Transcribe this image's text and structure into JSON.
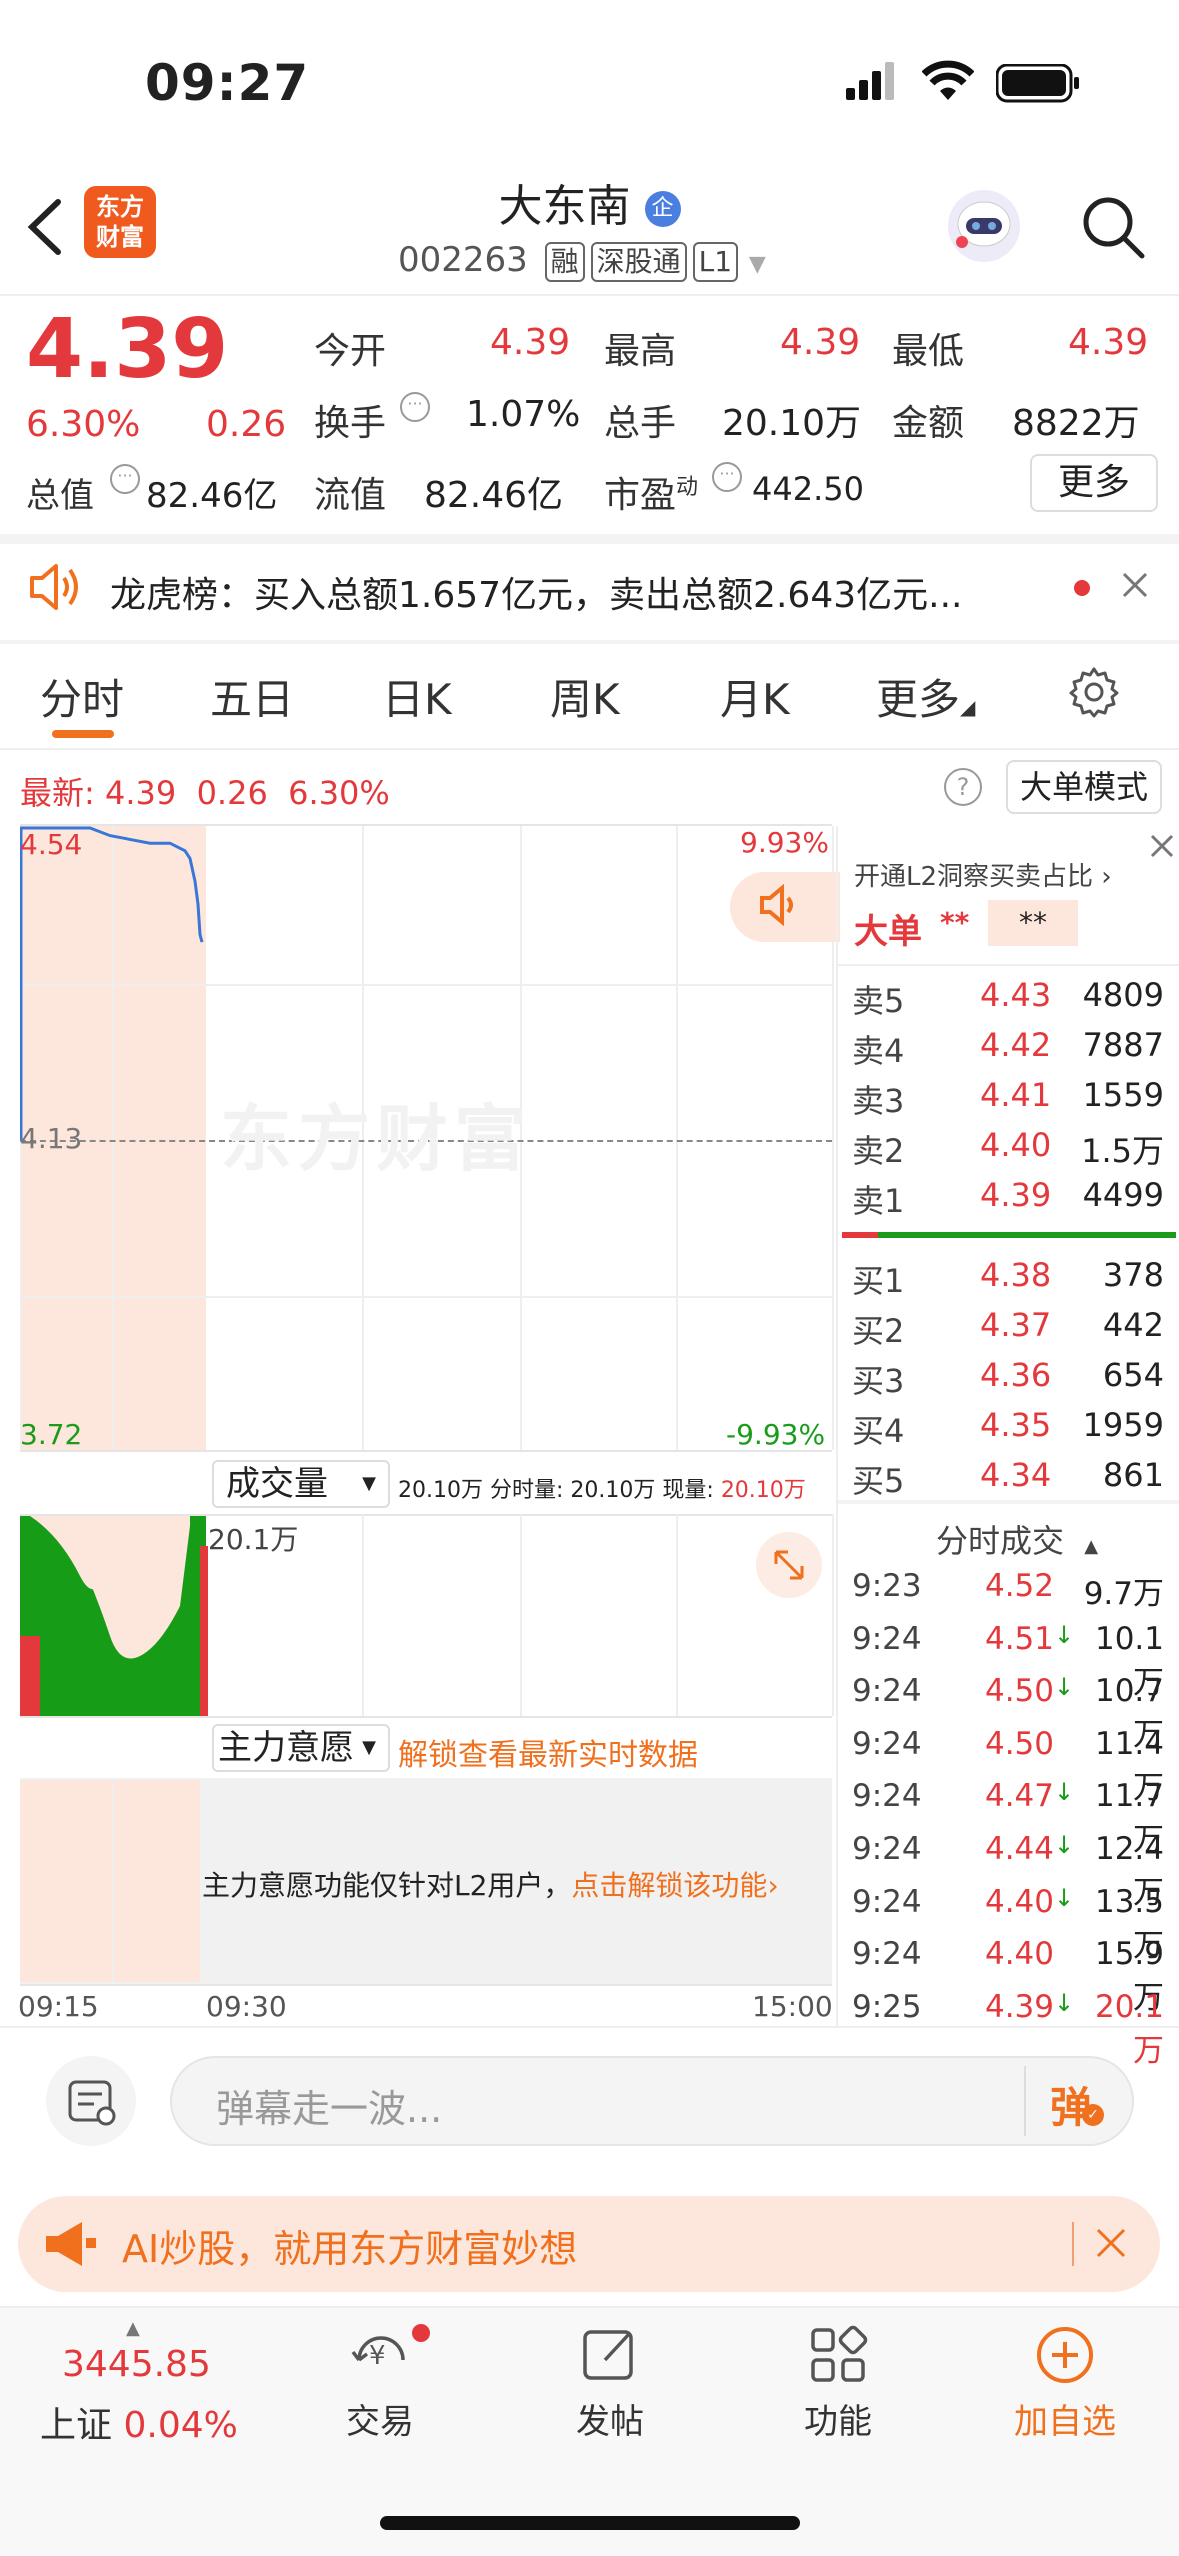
{
  "status": {
    "time": "09:27"
  },
  "header": {
    "title": "大东南",
    "ent_badge": "企",
    "code": "002263",
    "tags": [
      "融",
      "深股通",
      "L1"
    ]
  },
  "quote": {
    "price": "4.39",
    "pct": "6.30%",
    "chg": "0.26",
    "stats": [
      {
        "label": "今开",
        "value": "4.39",
        "red": true
      },
      {
        "label": "最高",
        "value": "4.39",
        "red": true
      },
      {
        "label": "最低",
        "value": "4.39",
        "red": true
      },
      {
        "label": "换手",
        "value": "1.07%"
      },
      {
        "label": "总手",
        "value": "20.10万"
      },
      {
        "label": "金额",
        "value": "8822万"
      },
      {
        "label": "总值",
        "value": "82.46亿"
      },
      {
        "label": "流值",
        "value": "82.46亿"
      },
      {
        "label": "市盈",
        "sup": "动",
        "value": "442.50"
      }
    ],
    "more_label": "更多"
  },
  "banner": {
    "text": "龙虎榜：买入总额1.657亿元，卖出总额2.643亿元..."
  },
  "tabs": [
    "分时",
    "五日",
    "日K",
    "周K",
    "月K",
    "更多"
  ],
  "latest": {
    "label": "最新:",
    "price": "4.39",
    "chg": "0.26",
    "pct": "6.30%"
  },
  "mode_label": "大单模式",
  "chart": {
    "y_high": "4.54",
    "y_mid": "4.13",
    "y_low": "3.72",
    "pct_high": "9.93%",
    "pct_low": "-9.93%",
    "watermark": "东方财富",
    "volume_max": "20.1万",
    "x_ticks": [
      "09:15",
      "09:30",
      "15:00"
    ],
    "price_line": [
      4.54,
      4.54,
      4.54,
      4.53,
      4.52,
      4.52,
      4.51,
      4.5,
      4.47,
      4.44,
      4.4,
      4.39
    ]
  },
  "volume": {
    "label": "成交量",
    "info1": "20.10万",
    "info2_label": "分时量:",
    "info2": "20.10万",
    "info3_label": "现量:",
    "info3": "20.10万"
  },
  "zhuli": {
    "label": "主力意愿",
    "unlock": "解锁查看最新实时数据",
    "msg": "主力意愿功能仅针对L2用户，",
    "link": "点击解锁该功能"
  },
  "orderbook": {
    "l2_text": "开通L2洞察买卖占比",
    "big_label": "大单",
    "big_v1": "**",
    "big_v2": "**",
    "asks": [
      {
        "label": "卖5",
        "price": "4.43",
        "vol": "4809"
      },
      {
        "label": "卖4",
        "price": "4.42",
        "vol": "7887"
      },
      {
        "label": "卖3",
        "price": "4.41",
        "vol": "1559"
      },
      {
        "label": "卖2",
        "price": "4.40",
        "vol": "1.5万"
      },
      {
        "label": "卖1",
        "price": "4.39",
        "vol": "4499"
      }
    ],
    "bids": [
      {
        "label": "买1",
        "price": "4.38",
        "vol": "378"
      },
      {
        "label": "买2",
        "price": "4.37",
        "vol": "442"
      },
      {
        "label": "买3",
        "price": "4.36",
        "vol": "654"
      },
      {
        "label": "买4",
        "price": "4.35",
        "vol": "1959"
      },
      {
        "label": "买5",
        "price": "4.34",
        "vol": "861"
      }
    ],
    "trades_label": "分时成交",
    "trades": [
      {
        "t": "9:23",
        "p": "4.52",
        "arrow": "",
        "v": "9.7万"
      },
      {
        "t": "9:24",
        "p": "4.51",
        "arrow": "↓",
        "v": "10.1万"
      },
      {
        "t": "9:24",
        "p": "4.50",
        "arrow": "↓",
        "v": "10.7万"
      },
      {
        "t": "9:24",
        "p": "4.50",
        "arrow": "",
        "v": "11.4万"
      },
      {
        "t": "9:24",
        "p": "4.47",
        "arrow": "↓",
        "v": "11.7万"
      },
      {
        "t": "9:24",
        "p": "4.44",
        "arrow": "↓",
        "v": "12.4万"
      },
      {
        "t": "9:24",
        "p": "4.40",
        "arrow": "↓",
        "v": "13.5万"
      },
      {
        "t": "9:24",
        "p": "4.40",
        "arrow": "",
        "v": "15.9万"
      },
      {
        "t": "9:25",
        "p": "4.39",
        "arrow": "↓",
        "v": "20.1万"
      }
    ]
  },
  "comment": {
    "placeholder": "弹幕走一波...",
    "send": "弹"
  },
  "ad": {
    "text": "AI炒股，就用东方财富妙想"
  },
  "bottom": {
    "index_value": "3445.85",
    "index_name": "上证",
    "index_pct": "0.04%",
    "items": [
      "交易",
      "发帖",
      "功能",
      "加自选"
    ]
  }
}
